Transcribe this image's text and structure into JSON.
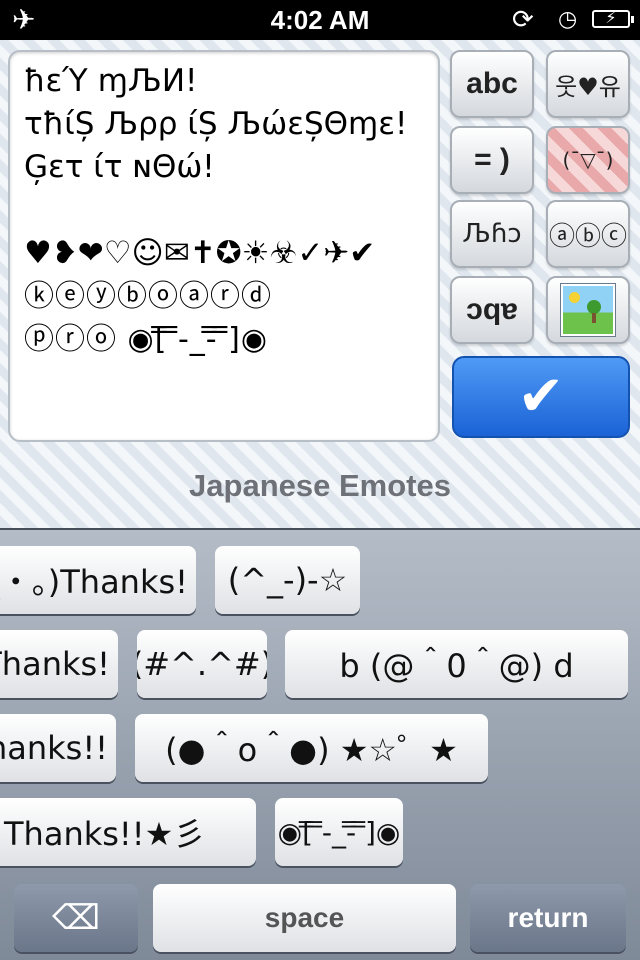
{
  "status_bar": {
    "airplane_icon": "airplane-icon",
    "airplane_glyph": "✈",
    "time": "4:02 AM",
    "rotation_lock_glyph": "⟳",
    "alarm_glyph": "◷",
    "battery_glyph": "⚡"
  },
  "editor": {
    "lines": [
      "ħεΎ ɱЉИ!",
      "τħίȘ Љρρ ίȘ ЉώεȘΘɱε!",
      "Ģετ ίτ ɴΘώ!",
      "",
      "♥❥❤♡☺✉✝✪☀☣✓✈✔",
      "ⓚⓔⓨⓑⓞⓐⓡⓓ",
      "ⓟⓡⓞ ◉[̿ ̿-_-̿ ̿]◉"
    ]
  },
  "style_buttons": {
    "abc": "abc",
    "hearts": "웃♥유",
    "smiley": "= )",
    "kaomoji": "(¯▽¯)",
    "fancy": "Љɦɔ",
    "circled": "ⓐⓑⓒ",
    "upside_down": "ɔqɐ",
    "picture_icon": "picture-icon",
    "done_glyph": "✔"
  },
  "section_title": "Japanese Emotes",
  "emote_keys": [
    [
      "_・。)Thanks!",
      "(^_-)-☆"
    ],
    [
      "Thanks!",
      "(#^.^#)",
      "b (@＾0＾@) d"
    ],
    [
      "hanks!!",
      "(●＾o＾●) ★☆゜★"
    ],
    [
      "Thanks!!★彡",
      "◉[̿ ̿-_-̿ ̿]◉"
    ]
  ],
  "bottom_keys": {
    "backspace_glyph": "⌫",
    "space": "space",
    "return": "return"
  },
  "colors": {
    "done_button": "#2b7bea",
    "keyboard_bg": "#8e98a6"
  }
}
